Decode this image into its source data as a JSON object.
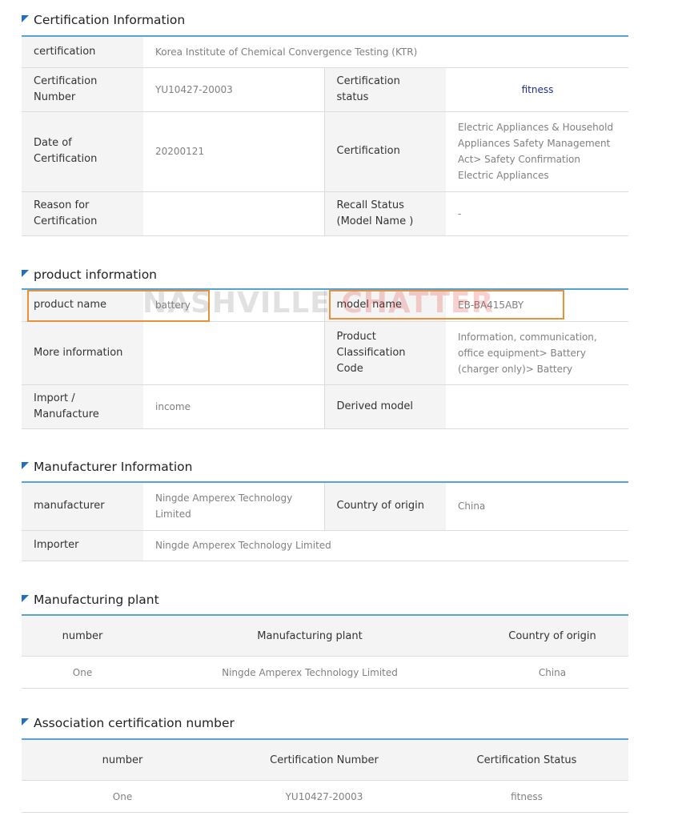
{
  "cert_info": {
    "title": "Certification Information",
    "rows": {
      "certification_label": "certification",
      "certification_value": "Korea Institute of Chemical Convergence Testing (KTR)",
      "number_label": "Certification Number",
      "number_value": "YU10427-20003",
      "status_label": "Certification status",
      "status_value": "fitness",
      "date_label": "Date of Certification",
      "date_value": "20200121",
      "cert_label": "Certification",
      "cert_value": "Electric Appliances & Household Appliances Safety Management Act> Safety Confirmation Electric Appliances",
      "reason_label": "Reason for Certification",
      "reason_value": "",
      "recall_label": "Recall Status (Model Name )",
      "recall_value": "-"
    }
  },
  "product_info": {
    "title": "product information",
    "rows": {
      "name_label": "product name",
      "name_value": "battery",
      "model_label": "model name",
      "model_value": "EB-BA415ABY",
      "more_label": "More information",
      "more_value": "",
      "class_label": "Product Classification Code",
      "class_value": "Information, communication, office equipment> Battery (charger only)> Battery",
      "import_label": "Import / Manufacture",
      "import_value": "income",
      "derived_label": "Derived model",
      "derived_value": ""
    }
  },
  "manufacturer_info": {
    "title": "Manufacturer Information",
    "rows": {
      "manufacturer_label": "manufacturer",
      "manufacturer_value": "Ningde Amperex Technology Limited",
      "country_label": "Country of origin",
      "country_value": "China",
      "importer_label": "Importer",
      "importer_value": "Ningde Amperex Technology Limited"
    }
  },
  "plant": {
    "title": "Manufacturing plant",
    "headers": [
      "number",
      "Manufacturing plant",
      "Country of origin"
    ],
    "rows": [
      [
        "One",
        "Ningde Amperex Technology Limited",
        "China"
      ]
    ]
  },
  "association": {
    "title": "Association certification number",
    "headers": [
      "number",
      "Certification Number",
      "Certification Status"
    ],
    "rows": [
      [
        "One",
        "YU10427-20003",
        "fitness"
      ]
    ]
  },
  "watermark": {
    "part1": "NASHVILLE ",
    "part2": "CHATTER"
  },
  "colors": {
    "accent": "#1f6fc7",
    "rule": "#55a4d6",
    "highlight": "#e8913a",
    "status": "#1c2c8a"
  }
}
